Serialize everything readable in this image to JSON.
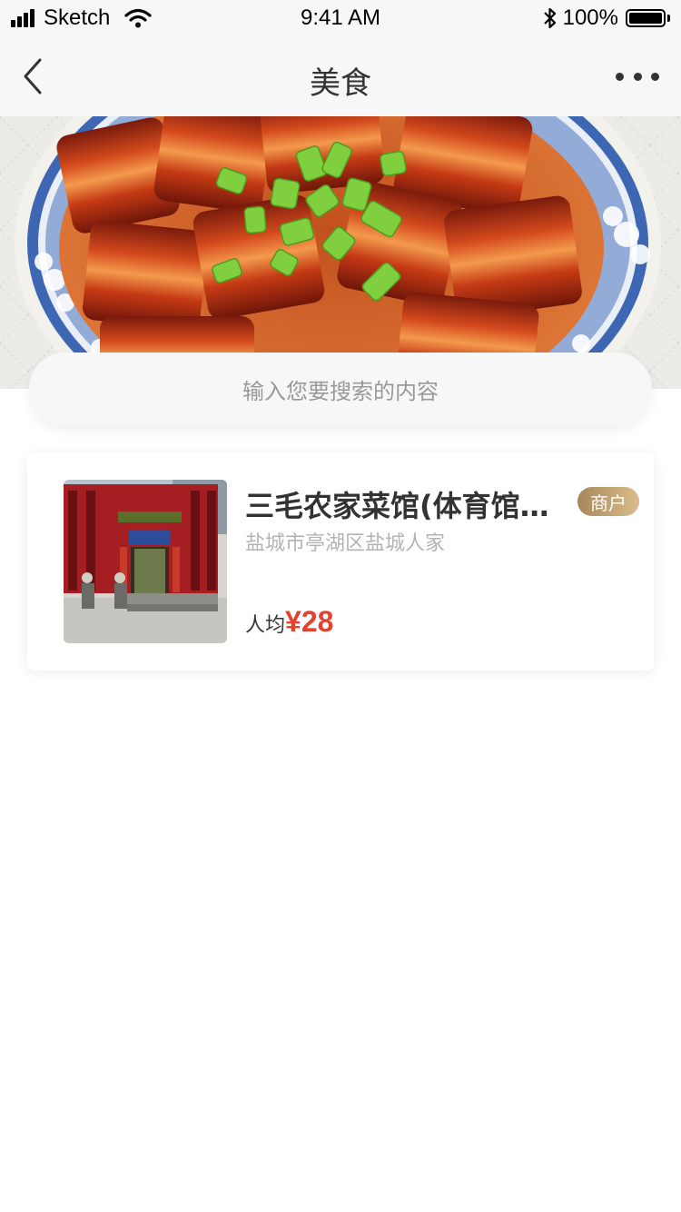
{
  "status_bar": {
    "carrier": "Sketch",
    "time": "9:41 AM",
    "battery": "100%"
  },
  "nav": {
    "title": "美食",
    "back_icon": "chevron-left-icon",
    "more_icon": "more-horizontal-icon"
  },
  "banner": {
    "image": "braised-pork-dish"
  },
  "search": {
    "placeholder": "输入您要搜索的内容"
  },
  "results": [
    {
      "name": "三毛农家菜馆(体育馆…",
      "badge": "商户",
      "address": "盐城市亭湖区盐城人家",
      "price_label": "人均",
      "price": "¥28",
      "image": "restaurant-storefront"
    }
  ],
  "colors": {
    "price": "#e5412d",
    "badge_start": "#a8875a",
    "badge_end": "#d9bd8c",
    "bar_bg": "#f7f7f7"
  }
}
